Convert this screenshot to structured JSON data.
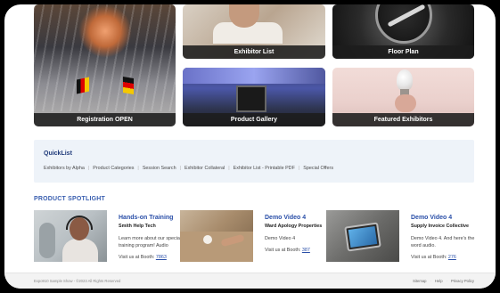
{
  "tiles": {
    "registration": "Registration OPEN",
    "exhibitor_list": "Exhibitor List",
    "floor_plan": "Floor Plan",
    "product_gallery": "Product Gallery",
    "featured_exhibitors": "Featured Exhibitors"
  },
  "quicklist": {
    "title": "QuickList",
    "links": [
      "Exhibitors by Alpha",
      "Product Categories",
      "Session Search",
      "Exhibitor Collateral",
      "Exhibitor List - Printable PDF",
      "Special Offers"
    ],
    "separator": "|"
  },
  "spotlight": {
    "title": "PRODUCT SPOTLIGHT",
    "cards": [
      {
        "title": "Hands-on Training",
        "company": "Smith Help Tech",
        "description": "Learn more about our special training program! Audio",
        "booth_label": "Visit us at Booth:",
        "booth": "7863"
      },
      {
        "title": "Demo Video 4",
        "company": "Ward Apology Properties",
        "description": "Demo Video 4",
        "booth_label": "Visit us at Booth:",
        "booth": "387"
      },
      {
        "title": "Demo Video 4",
        "company": "Supply Invoice Collective",
        "description": "Demo Video 4. And here's the word audio.",
        "booth_label": "Visit us at Booth:",
        "booth": "276"
      }
    ]
  },
  "footer": {
    "copyright": "Expo910 Sample Show - ©2023 All Rights Reserved",
    "links": [
      "Sitemap",
      "Help",
      "Privacy Policy"
    ],
    "separator": "·"
  }
}
